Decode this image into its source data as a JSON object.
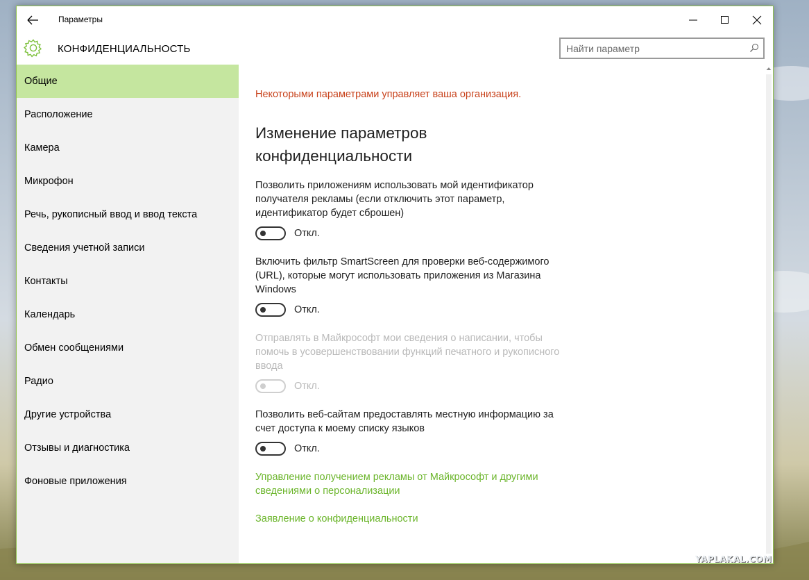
{
  "window": {
    "app_title": "Параметры",
    "page_title": "КОНФИДЕНЦИАЛЬНОСТЬ"
  },
  "search": {
    "placeholder": "Найти параметр",
    "value": ""
  },
  "icons": {
    "back": "back-arrow-icon",
    "gear": "gear-icon",
    "search": "search-icon",
    "minimize": "minimize-icon",
    "maximize": "maximize-icon",
    "close": "close-icon"
  },
  "colors": {
    "accent": "#c5e69f",
    "link": "#6bb52b",
    "notice": "#c8421b"
  },
  "sidebar": {
    "items": [
      {
        "label": "Общие",
        "active": true
      },
      {
        "label": "Расположение",
        "active": false
      },
      {
        "label": "Камера",
        "active": false
      },
      {
        "label": "Микрофон",
        "active": false
      },
      {
        "label": "Речь, рукописный ввод и ввод текста",
        "active": false
      },
      {
        "label": "Сведения учетной записи",
        "active": false
      },
      {
        "label": "Контакты",
        "active": false
      },
      {
        "label": "Календарь",
        "active": false
      },
      {
        "label": "Обмен сообщениями",
        "active": false
      },
      {
        "label": "Радио",
        "active": false
      },
      {
        "label": "Другие устройства",
        "active": false
      },
      {
        "label": "Отзывы и диагностика",
        "active": false
      },
      {
        "label": "Фоновые приложения",
        "active": false
      }
    ]
  },
  "main": {
    "notice": "Некоторыми параметрами управляет ваша организация.",
    "section_title": "Изменение параметров конфиденциальности",
    "settings": [
      {
        "description": "Позволить приложениям использовать мой идентификатор получателя рекламы (если отключить этот параметр, идентификатор будет сброшен)",
        "state_label": "Откл.",
        "on": false,
        "disabled": false
      },
      {
        "description": "Включить фильтр SmartScreen для проверки веб-содержимого (URL), которые могут использовать приложения из Магазина Windows",
        "state_label": "Откл.",
        "on": false,
        "disabled": false
      },
      {
        "description": "Отправлять в Майкрософт мои сведения о написании, чтобы помочь в усовершенствовании функций печатного и рукописного ввода",
        "state_label": "Откл.",
        "on": false,
        "disabled": true
      },
      {
        "description": "Позволить веб-сайтам предоставлять местную информацию за счет доступа к моему списку языков",
        "state_label": "Откл.",
        "on": false,
        "disabled": false
      }
    ],
    "links": [
      {
        "label": "Управление получением рекламы от Майкрософт и другими сведениями о персонализации"
      },
      {
        "label": "Заявление о конфиденциальности"
      }
    ]
  },
  "watermark": "YAPLAKAL.COM"
}
